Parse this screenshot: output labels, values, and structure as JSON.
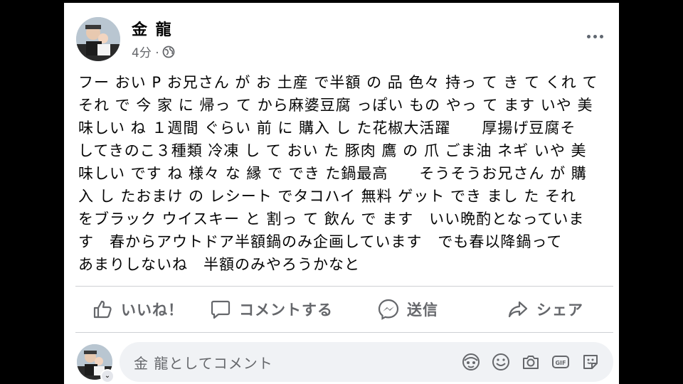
{
  "post": {
    "author": "金 龍",
    "time": "4分 ·",
    "text": "フー おい P お兄さん が お 土産 で半額 の 品 色々 持っ て き て くれ て\nそれ で 今 家 に 帰っ て から麻婆豆腐 っぽい もの やっ て ます いや 美\n味しい ね １週間 ぐらい 前 に 購入 し た花椒大活躍　　厚揚げ豆腐そ\nしてきのこ３種類 冷凍 し て おい た 豚肉 鷹 の 爪 ごま油 ネギ いや 美\n味しい です ね 様々 な 縁 で でき た鍋最高　　そうそうお兄さん が 購\n入 し たおまけ の レシート でタコハイ 無料 ゲット でき まし た それ\nをブラック ウイスキー と 割っ て 飲ん で ます　いい晩酌となっていま\nす　春からアウトドア半額鍋のみ企画しています　でも春以降鍋って\nあまりしないね　半額のみやろうかなと",
    "icons": [
      "globe-icon",
      "more-options-icon"
    ]
  },
  "actions": {
    "like": "いいね！",
    "comment": "コメントする",
    "send": "送信",
    "share": "シェア",
    "icons": [
      "thumbs-up-icon",
      "comment-icon",
      "messenger-icon",
      "share-icon"
    ]
  },
  "comment_input": {
    "placeholder": "金 龍としてコメント",
    "icons": [
      "avatar-sticker-icon",
      "emoji-icon",
      "camera-icon",
      "gif-icon",
      "sticker-icon"
    ]
  },
  "colors": {
    "background": "#000000",
    "card": "#ffffff",
    "text": "#050505",
    "secondary_text": "#65676b",
    "divider": "#ced0d4",
    "input_bg": "#f0f2f5"
  }
}
